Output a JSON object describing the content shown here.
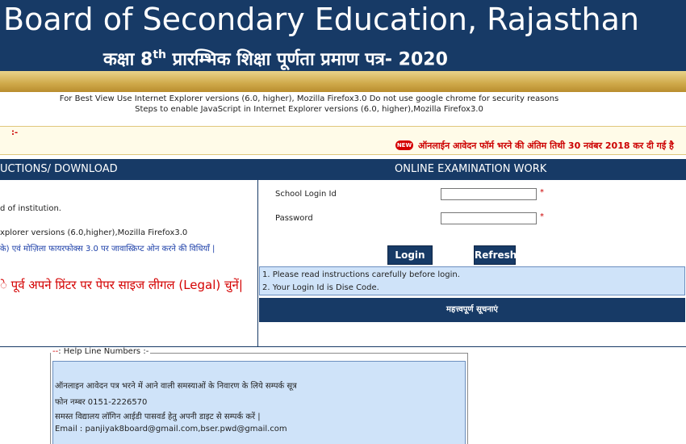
{
  "header": {
    "title": "Board of Secondary Education, Rajasthan",
    "subtitle_part1": "कक्षा 8",
    "subtitle_sup": "th",
    "subtitle_part2": " प्रारम्भिक शिक्षा पूर्णता प्रमाण पत्र- 2020"
  },
  "notes": {
    "line1": "For Best View Use Internet Explorer versions (6.0, higher), Mozilla Firefox3.0 Do not use google chrome for security reasons",
    "line2": "Steps to enable JavaScript in Internet Explorer versions (6.0, higher),Mozilla Firefox3.0"
  },
  "marquee": {
    "prefix": ":-",
    "badge": "NEW",
    "text": "ऑनलाईन आवेदन फॉर्म भरने की अंतिम तिथी 30 नवंबर 2018 कर दी गई है"
  },
  "sections": {
    "left_title": "UCTIONS/ DOWNLOAD",
    "right_title": "ONLINE EXAMINATION WORK"
  },
  "left_panel": {
    "line1": "d of institution.",
    "line2": "xplorer versions (6.0,higher),Mozilla Firefox3.0",
    "line3": "के) एवं मोज़िला फायरफोक्स 3.0 पर जावास्क्रिप्ट ओन करने की विधियाँ |",
    "line4": "े पूर्व अपने प्रिंटर पर पेपर साइज लीगल (Legal) चुनें|"
  },
  "login": {
    "school_login_label": "School Login Id",
    "school_login_value": "",
    "password_label": "Password",
    "password_value": "",
    "required_mark": "*",
    "login_button": "Login",
    "refresh_button": "Refresh",
    "instruction_1": "1. Please read instructions carefully before login.",
    "instruction_2": "2. Your Login Id is Dise Code.",
    "notice_button": "महत्त्वपूर्ण सूचनाएं"
  },
  "helpline": {
    "legend_prefix": "--",
    "legend_text": ": Help Line Numbers :-",
    "line1": "ऑनलाइन आवेदन पत्र भरने में आने वाली समस्याओं के निवारण के लिये सम्पर्क सूत्र",
    "line2": "फोन नम्बर   0151-2226570",
    "line3": "समस्त विद्यालय लॉगिन आईडी पासवर्ड हेतु अपनी डाइट से सम्पर्क करें |",
    "line4": "Email : panjiyak8board@gmail.com,bser.pwd@gmail.com"
  }
}
